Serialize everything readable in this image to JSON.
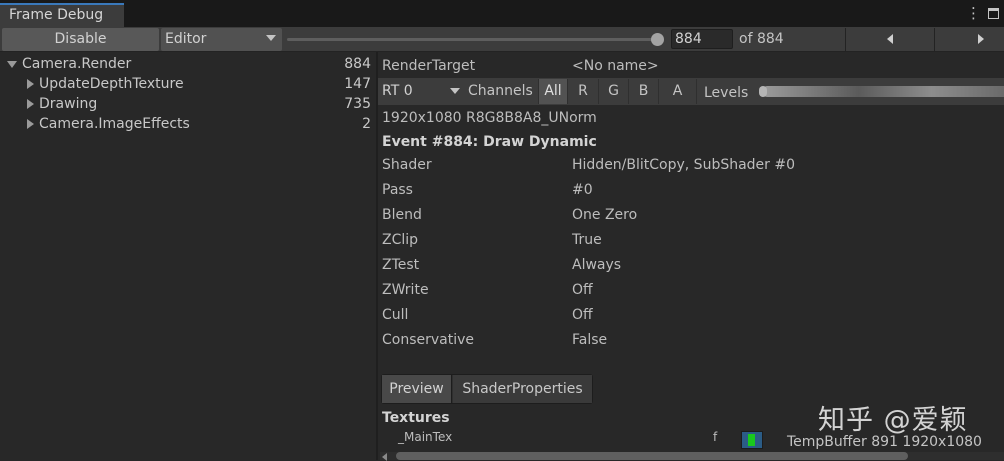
{
  "window": {
    "tab_title": "Frame Debug"
  },
  "toolbar": {
    "disable_label": "Disable",
    "target_selected": "Editor",
    "event_index": "884",
    "of_label": "of 884"
  },
  "tree": {
    "items": [
      {
        "label": "Camera.Render",
        "count": "884",
        "expanded": true,
        "depth": 0
      },
      {
        "label": "UpdateDepthTexture",
        "count": "147",
        "expanded": false,
        "depth": 1
      },
      {
        "label": "Drawing",
        "count": "735",
        "expanded": false,
        "depth": 1
      },
      {
        "label": "Camera.ImageEffects",
        "count": "2",
        "expanded": false,
        "depth": 1
      }
    ]
  },
  "details": {
    "render_target_label": "RenderTarget",
    "render_target_value": "<No name>",
    "rt_selected": "RT 0",
    "channels_label": "Channels",
    "channels": [
      "All",
      "R",
      "G",
      "B",
      "A"
    ],
    "channel_selected": "All",
    "levels_label": "Levels",
    "format": "1920x1080 R8G8B8A8_UNorm",
    "event_title": "Event #884: Draw Dynamic",
    "properties": [
      {
        "label": "Shader",
        "value": "Hidden/BlitCopy, SubShader #0"
      },
      {
        "label": "Pass",
        "value": "#0"
      },
      {
        "label": "Blend",
        "value": "One Zero"
      },
      {
        "label": "ZClip",
        "value": "True"
      },
      {
        "label": "ZTest",
        "value": "Always"
      },
      {
        "label": "ZWrite",
        "value": "Off"
      },
      {
        "label": "Cull",
        "value": "Off"
      },
      {
        "label": "Conservative",
        "value": "False"
      }
    ],
    "tabs": [
      "Preview",
      "ShaderProperties"
    ],
    "textures_label": "Textures",
    "texture": {
      "name": "_MainTex",
      "flag": "f",
      "value": "TempBuffer 891 1920x1080"
    }
  },
  "watermark": "知乎 @爱颖",
  "colors": {
    "accent": "#3a79bb",
    "swatch_bg": "#2b5c86",
    "swatch_fg": "#19c81d"
  }
}
